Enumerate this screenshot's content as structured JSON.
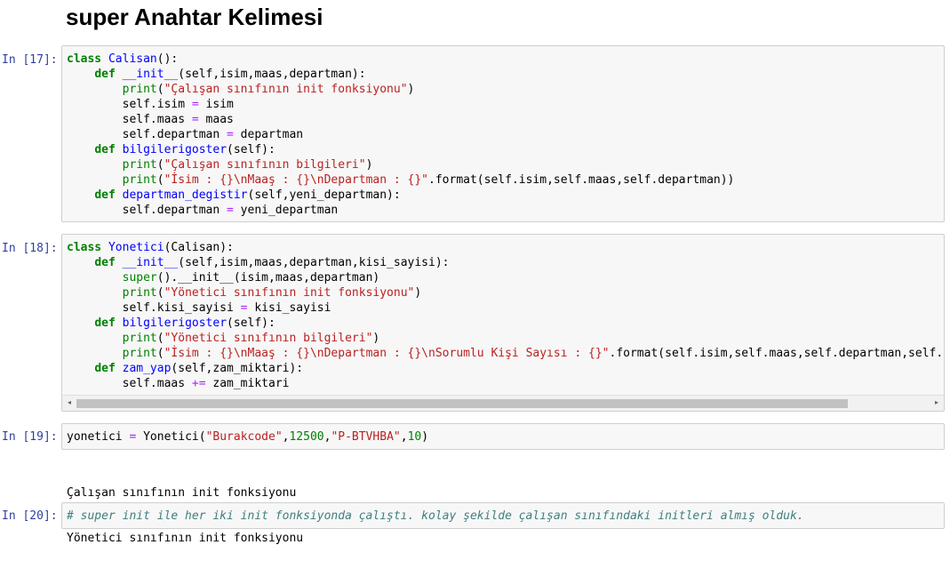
{
  "heading": "super Anahtar Kelimesi",
  "cells": [
    {
      "prompt": "In [17]:",
      "lines": [
        [
          [
            "kw",
            "class"
          ],
          [
            "t",
            " "
          ],
          [
            "fn",
            "Calisan"
          ],
          [
            "t",
            "():"
          ]
        ],
        [
          [
            "t",
            "    "
          ],
          [
            "kw",
            "def"
          ],
          [
            "t",
            " "
          ],
          [
            "fn",
            "__init__"
          ],
          [
            "t",
            "(self,isim,maas,departman):"
          ]
        ],
        [
          [
            "t",
            "        "
          ],
          [
            "kw2",
            "print"
          ],
          [
            "t",
            "("
          ],
          [
            "st",
            "\"Çalışan sınıfının init fonksiyonu\""
          ],
          [
            "t",
            ")"
          ]
        ],
        [
          [
            "t",
            "        self.isim "
          ],
          [
            "op",
            "="
          ],
          [
            "t",
            " isim"
          ]
        ],
        [
          [
            "t",
            "        self.maas "
          ],
          [
            "op",
            "="
          ],
          [
            "t",
            " maas"
          ]
        ],
        [
          [
            "t",
            "        self.departman "
          ],
          [
            "op",
            "="
          ],
          [
            "t",
            " departman"
          ]
        ],
        [
          [
            "t",
            "    "
          ],
          [
            "kw",
            "def"
          ],
          [
            "t",
            " "
          ],
          [
            "fn",
            "bilgilerigoster"
          ],
          [
            "t",
            "(self):"
          ]
        ],
        [
          [
            "t",
            "        "
          ],
          [
            "kw2",
            "print"
          ],
          [
            "t",
            "("
          ],
          [
            "st",
            "\"Çalışan sınıfının bilgileri\""
          ],
          [
            "t",
            ")"
          ]
        ],
        [
          [
            "t",
            "        "
          ],
          [
            "kw2",
            "print"
          ],
          [
            "t",
            "("
          ],
          [
            "st",
            "\"İsim : {}\\nMaaş : {}\\nDepartman : {}\""
          ],
          [
            "t",
            ".format(self.isim,self.maas,self.departman))"
          ]
        ],
        [
          [
            "t",
            "    "
          ],
          [
            "kw",
            "def"
          ],
          [
            "t",
            " "
          ],
          [
            "fn",
            "departman_degistir"
          ],
          [
            "t",
            "(self,yeni_departman):"
          ]
        ],
        [
          [
            "t",
            "        self.departman "
          ],
          [
            "op",
            "="
          ],
          [
            "t",
            " yeni_departman"
          ]
        ]
      ]
    },
    {
      "prompt": "In [18]:",
      "lines": [
        [
          [
            "kw",
            "class"
          ],
          [
            "t",
            " "
          ],
          [
            "fn",
            "Yonetici"
          ],
          [
            "t",
            "(Calisan):"
          ]
        ],
        [
          [
            "t",
            "    "
          ],
          [
            "kw",
            "def"
          ],
          [
            "t",
            " "
          ],
          [
            "fn",
            "__init__"
          ],
          [
            "t",
            "(self,isim,maas,departman,kisi_sayisi):"
          ]
        ],
        [
          [
            "t",
            "        "
          ],
          [
            "kw2",
            "super"
          ],
          [
            "t",
            "().__init__(isim,maas,departman)"
          ]
        ],
        [
          [
            "t",
            "        "
          ],
          [
            "kw2",
            "print"
          ],
          [
            "t",
            "("
          ],
          [
            "st",
            "\"Yönetici sınıfının init fonksiyonu\""
          ],
          [
            "t",
            ")"
          ]
        ],
        [
          [
            "t",
            "        self.kisi_sayisi "
          ],
          [
            "op",
            "="
          ],
          [
            "t",
            " kisi_sayisi"
          ]
        ],
        [
          [
            "t",
            "    "
          ],
          [
            "kw",
            "def"
          ],
          [
            "t",
            " "
          ],
          [
            "fn",
            "bilgilerigoster"
          ],
          [
            "t",
            "(self):"
          ]
        ],
        [
          [
            "t",
            "        "
          ],
          [
            "kw2",
            "print"
          ],
          [
            "t",
            "("
          ],
          [
            "st",
            "\"Yönetici sınıfının bilgileri\""
          ],
          [
            "t",
            ")"
          ]
        ],
        [
          [
            "t",
            "        "
          ],
          [
            "kw2",
            "print"
          ],
          [
            "t",
            "("
          ],
          [
            "st",
            "\"İsim : {}\\nMaaş : {}\\nDepartman : {}\\nSorumlu Kişi Sayısı : {}\""
          ],
          [
            "t",
            ".format(self.isim,self.maas,self.departman,self.kis"
          ]
        ],
        [
          [
            "t",
            "    "
          ],
          [
            "kw",
            "def"
          ],
          [
            "t",
            " "
          ],
          [
            "fn",
            "zam_yap"
          ],
          [
            "t",
            "(self,zam_miktari):"
          ]
        ],
        [
          [
            "t",
            "        self.maas "
          ],
          [
            "op",
            "+="
          ],
          [
            "t",
            " zam_miktari"
          ]
        ]
      ]
    },
    {
      "prompt": "In [19]:",
      "lines": [
        [
          [
            "t",
            "yonetici "
          ],
          [
            "op",
            "="
          ],
          [
            "t",
            " Yonetici("
          ],
          [
            "st",
            "\"Burakcode\""
          ],
          [
            "t",
            ","
          ],
          [
            "nu",
            "12500"
          ],
          [
            "t",
            ","
          ],
          [
            "st",
            "\"P-BTVHBA\""
          ],
          [
            "t",
            ","
          ],
          [
            "nu",
            "10"
          ],
          [
            "t",
            ")"
          ]
        ]
      ]
    },
    {
      "prompt": "In [20]:",
      "lines": [
        [
          [
            "cm",
            "# super init ile her iki init fonksiyonda çalıştı. kolay şekilde çalışan sınıfındaki initleri almış olduk."
          ]
        ]
      ]
    }
  ],
  "output_19": [
    "Çalışan sınıfının init fonksiyonu",
    "Yönetici sınıfının init fonksiyonu"
  ],
  "scrollbar": {
    "left_arrow_icon": "◂",
    "right_arrow_icon": "▸"
  },
  "colors": {
    "keyword": "#008000",
    "builtin": "#008000",
    "function_name": "#0000ff",
    "string": "#ba2121",
    "operator": "#aa22ff",
    "comment": "#408080",
    "prompt": "#303f9f"
  }
}
